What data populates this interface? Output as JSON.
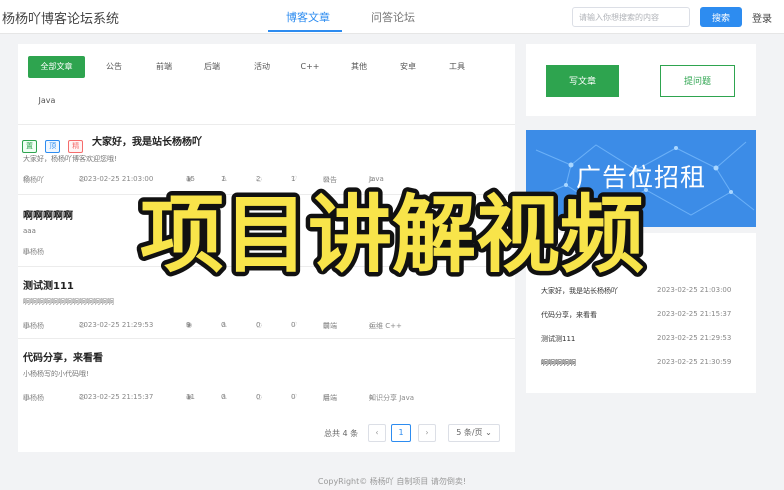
{
  "header": {
    "brand": "杨杨吖博客论坛系统",
    "tabs": [
      {
        "label": "博客文章",
        "active": true
      },
      {
        "label": "问答论坛",
        "active": false
      }
    ],
    "search_placeholder": "请输入你想搜索的内容",
    "search_button": "搜索",
    "login": "登录"
  },
  "categories": [
    "全部文章",
    "公告",
    "前端",
    "后端",
    "活动",
    "C++",
    "其他",
    "安卓",
    "工具",
    "Java"
  ],
  "articles": [
    {
      "tags": [
        {
          "text": "置",
          "color": "#2ea44f"
        },
        {
          "text": "顶",
          "color": "#2d8cf0"
        },
        {
          "text": "精",
          "color": "#f56c6c"
        }
      ],
      "title": "大家好，我是站长杨杨吖",
      "desc": "大家好，杨杨吖博客欢迎您哦!",
      "author": "杨杨吖",
      "time": "2023-02-25 21:03:00",
      "views": "15",
      "likes": "1",
      "comments": "2",
      "favorites": "1",
      "category": "公告",
      "label": "Java"
    },
    {
      "tags": [],
      "title": "啊啊啊啊啊",
      "desc": "aaa",
      "author": "小杨杨",
      "time": "",
      "views": "",
      "likes": "",
      "comments": "",
      "favorites": "",
      "category": "",
      "label": ""
    },
    {
      "tags": [],
      "title": "测试测111",
      "desc": "啊啊啊啊啊啊啊啊啊啊啊啊啊",
      "author": "小杨杨",
      "time": "2023-02-25 21:29:53",
      "views": "9",
      "likes": "0",
      "comments": "0",
      "favorites": "0",
      "category": "前端",
      "label": "运维 C++"
    },
    {
      "tags": [],
      "title": "代码分享，来看看",
      "desc": "小杨杨写的小代码哦!",
      "author": "小杨杨",
      "time": "2023-02-25 21:15:37",
      "views": "11",
      "likes": "0",
      "comments": "0",
      "favorites": "0",
      "category": "后端",
      "label": "知识分享 Java"
    }
  ],
  "pagination": {
    "total": "总共 4 条",
    "prev": "‹",
    "current": "1",
    "next": "›",
    "page_size": "5 条/页"
  },
  "sidebar": {
    "write_button": "写文章",
    "ask_button": "提问题",
    "ad_text": "广告位招租",
    "recent": [
      {
        "title": "大家好，我是站长杨杨吖",
        "time": "2023-02-25 21:03:00"
      },
      {
        "title": "代码分享，来看看",
        "time": "2023-02-25 21:15:37"
      },
      {
        "title": "测试测111",
        "time": "2023-02-25 21:29:53"
      },
      {
        "title": "啊啊啊啊啊",
        "time": "2023-02-25 21:30:59"
      }
    ]
  },
  "overlay_title": "项目讲解视频",
  "footer": "CopyRight© 杨杨吖 自制项目 请勿倒卖!",
  "icons": {
    "avatar": "avatar-icon",
    "image": "image-icon",
    "views": "eye-icon",
    "likes": "thumbs-up-icon",
    "comments": "comment-icon",
    "favorites": "heart-icon",
    "category": "folder-icon",
    "label": "tag-icon"
  },
  "colors": {
    "primary": "#2d8cf0",
    "green": "#2ea44f",
    "overlay_fill": "#f8e44a"
  }
}
